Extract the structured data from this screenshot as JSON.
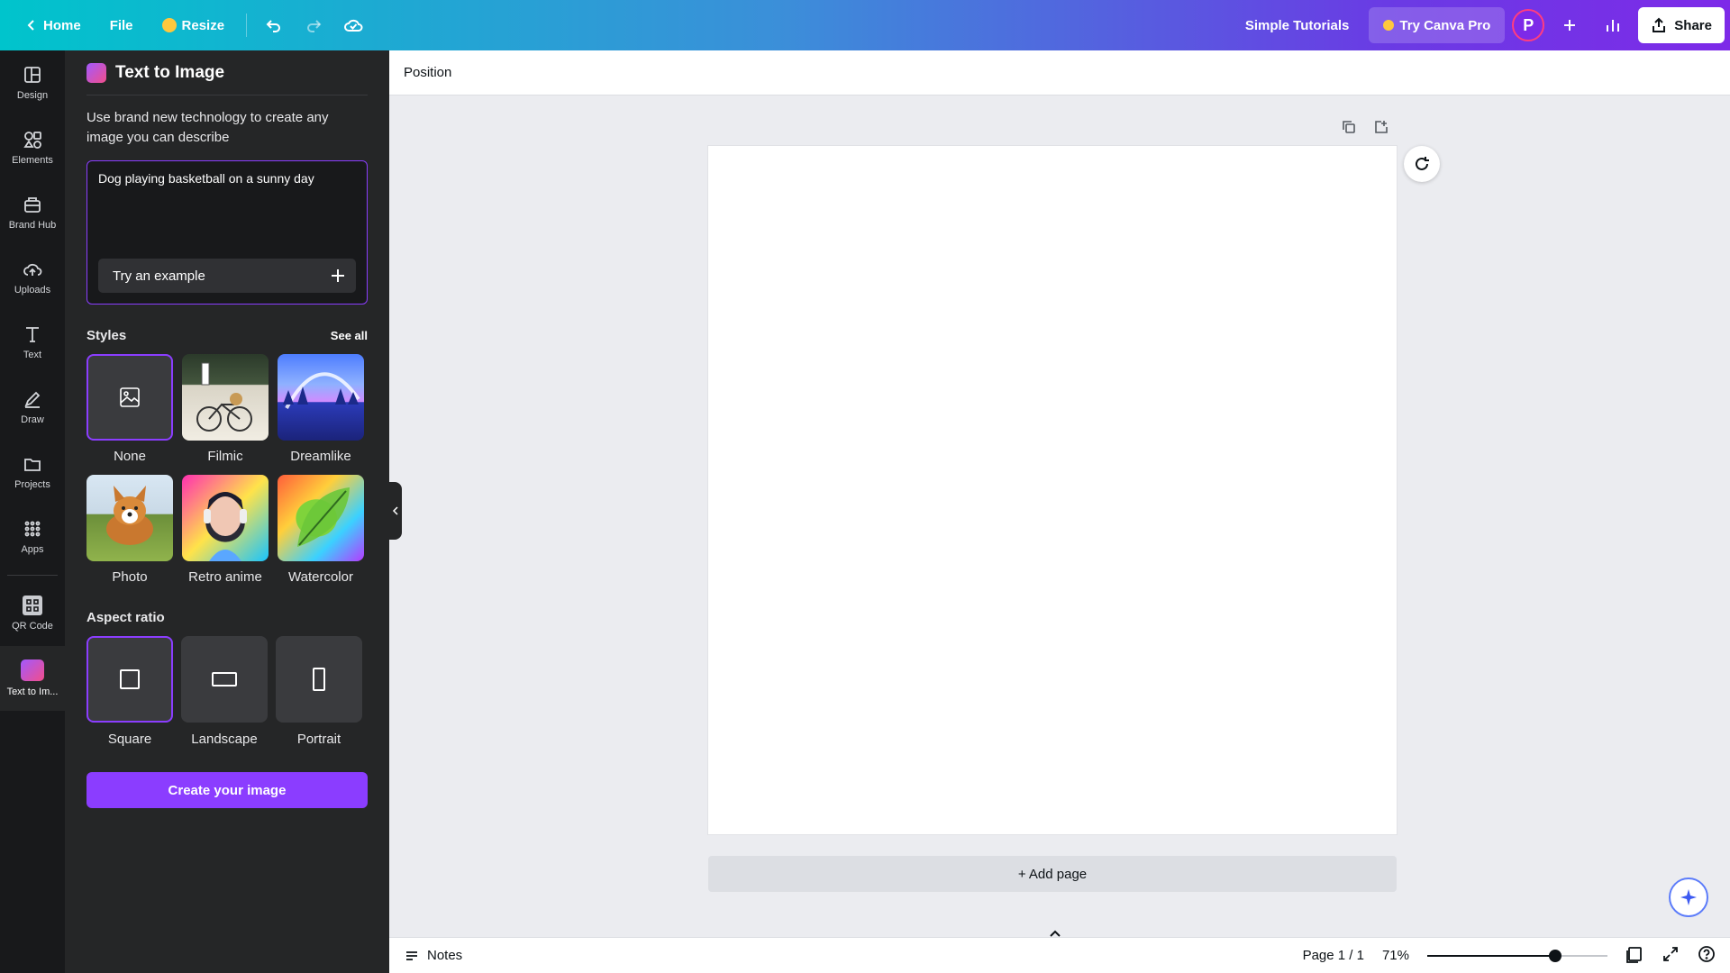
{
  "topbar": {
    "home_label": "Home",
    "file_label": "File",
    "resize_label": "Resize",
    "title": "Simple Tutorials",
    "pro_label": "Try Canva Pro",
    "avatar_letter": "P",
    "share_label": "Share"
  },
  "rail": {
    "items": [
      {
        "label": "Design",
        "icon": "design-icon"
      },
      {
        "label": "Elements",
        "icon": "elements-icon"
      },
      {
        "label": "Brand Hub",
        "icon": "brand-hub-icon"
      },
      {
        "label": "Uploads",
        "icon": "uploads-icon"
      },
      {
        "label": "Text",
        "icon": "text-icon"
      },
      {
        "label": "Draw",
        "icon": "draw-icon"
      },
      {
        "label": "Projects",
        "icon": "projects-icon"
      },
      {
        "label": "Apps",
        "icon": "apps-icon"
      },
      {
        "label": "QR Code",
        "icon": "qr-code-icon"
      },
      {
        "label": "Text to Im...",
        "icon": "text-to-image-icon"
      }
    ]
  },
  "panel": {
    "title": "Text to Image",
    "description": "Use brand new technology to create any image you can describe",
    "prompt_value": "Dog playing basketball on a sunny day",
    "example_label": "Try an example",
    "styles_label": "Styles",
    "see_all_label": "See all",
    "styles": [
      {
        "name": "None"
      },
      {
        "name": "Filmic"
      },
      {
        "name": "Dreamlike"
      },
      {
        "name": "Photo"
      },
      {
        "name": "Retro anime"
      },
      {
        "name": "Watercolor"
      }
    ],
    "aspect_label": "Aspect ratio",
    "aspects": [
      {
        "name": "Square"
      },
      {
        "name": "Landscape"
      },
      {
        "name": "Portrait"
      }
    ],
    "create_label": "Create your image"
  },
  "context_bar": {
    "position_label": "Position"
  },
  "canvas": {
    "add_page_label": "+ Add page"
  },
  "bottombar": {
    "notes_label": "Notes",
    "page_label": "Page 1 / 1",
    "zoom_label": "71%",
    "zoom_value": 0.71,
    "pages_count": "1"
  },
  "colors": {
    "accent": "#8b3dff",
    "panel_bg": "#252627",
    "rail_bg": "#18191b"
  }
}
